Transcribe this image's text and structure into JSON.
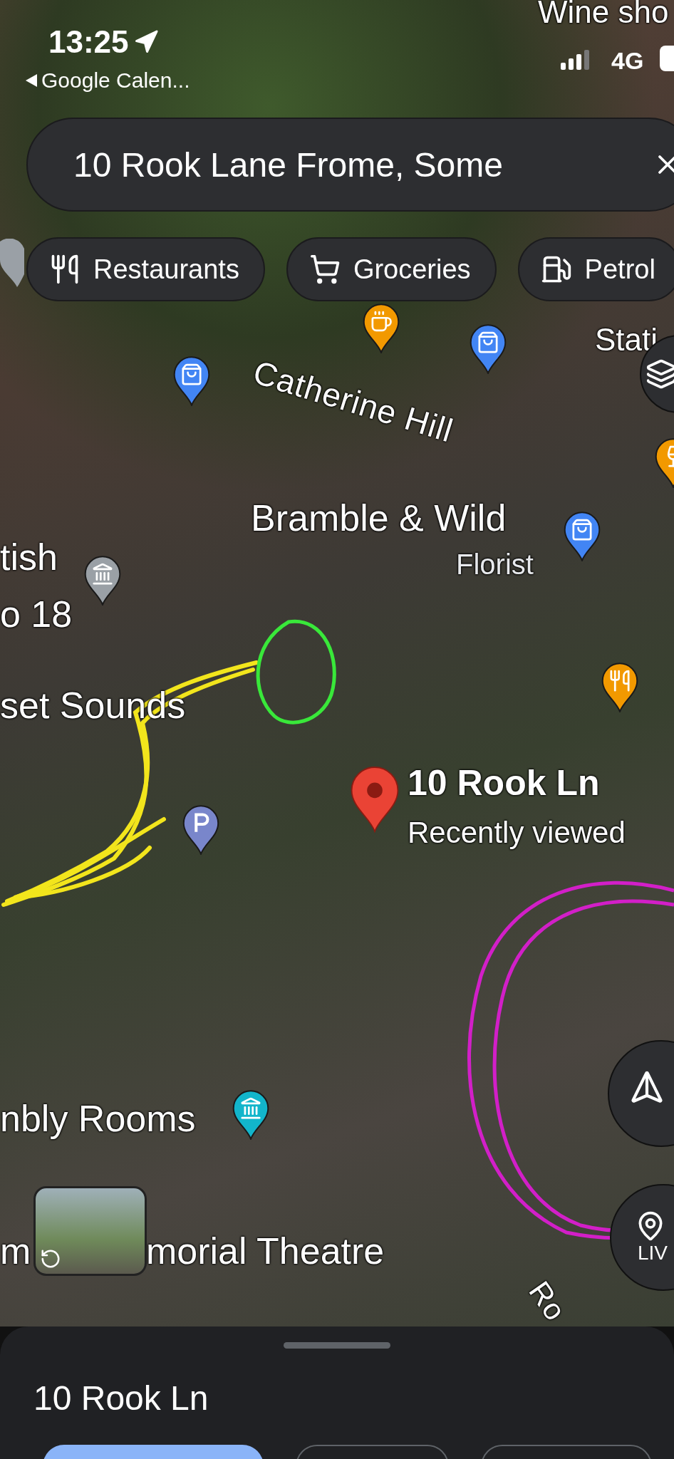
{
  "status_bar": {
    "time": "13:25",
    "back_app": "Google Calen...",
    "network": "4G"
  },
  "search": {
    "value": "10 Rook Lane Frome, Some"
  },
  "chips": [
    {
      "label": "Restaurants",
      "kind": "restaurant"
    },
    {
      "label": "Groceries",
      "kind": "groceries"
    },
    {
      "label": "Petrol",
      "kind": "petrol"
    }
  ],
  "map_labels": [
    {
      "text": "Wine sho",
      "kind": "place"
    },
    {
      "text": "Stati",
      "kind": "place"
    },
    {
      "text": "Catherine Hill",
      "kind": "street"
    },
    {
      "text": "Bramble & Wild",
      "kind": "place"
    },
    {
      "text": "Florist",
      "kind": "category"
    },
    {
      "text": "tish",
      "kind": "place"
    },
    {
      "text": "o 18",
      "kind": "place"
    },
    {
      "text": "set Sounds",
      "kind": "place"
    },
    {
      "text": "nbly Rooms",
      "kind": "place"
    },
    {
      "text": "m",
      "kind": "place"
    },
    {
      "text": "morial Theatre",
      "kind": "place"
    },
    {
      "text": "Ro",
      "kind": "street"
    }
  ],
  "selected_place": {
    "name": "10 Rook Ln",
    "subtitle": "Recently viewed"
  },
  "live_button": {
    "label": "LIV"
  },
  "sheet": {
    "title": "10 Rook Ln"
  }
}
